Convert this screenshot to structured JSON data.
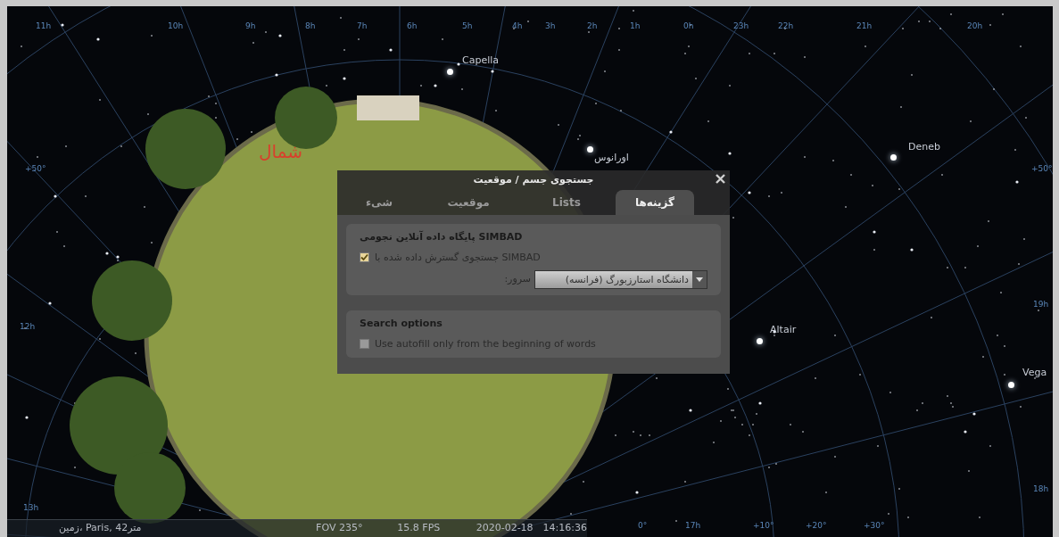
{
  "sky": {
    "hour_labels": [
      "11h",
      "10h",
      "9h",
      "8h",
      "7h",
      "6h",
      "5h",
      "4h",
      "3h",
      "2h",
      "1h",
      "0h",
      "23h",
      "22h",
      "21h",
      "20h"
    ],
    "side_labels": [
      "+50°",
      "12h",
      "13h"
    ],
    "right_labels": [
      "+50°",
      "19h",
      "18h"
    ],
    "bottom_labels": [
      "0°",
      "17h",
      "+10°",
      "+20°",
      "+30°"
    ],
    "star_labels": [
      {
        "name": "Capella"
      },
      {
        "name": "Deneb"
      },
      {
        "name": "Altair"
      },
      {
        "name": "Vega"
      },
      {
        "name": "اورانوس"
      }
    ],
    "cardinal": "شمال"
  },
  "dialog": {
    "title": "جستجوی جسم / موقعیت",
    "tabs": [
      {
        "label": "گزینه‌ها",
        "selected": true
      },
      {
        "label": "Lists",
        "selected": false
      },
      {
        "label": "موقعیت",
        "selected": false
      },
      {
        "label": "شیء",
        "selected": false
      }
    ],
    "groups": [
      {
        "kind": "simbad",
        "title": "SIMBAD پایگاه داده آنلاین نجومی",
        "checkbox": {
          "label": "SIMBAD جستجوی گسترش داده شده با",
          "checked": true
        },
        "server_label": "سرور:",
        "server_value": "دانشگاه استارزبورگ (فرانسه)"
      },
      {
        "kind": "options",
        "title": "Search options",
        "checkbox": {
          "label": "Use autofill only from the beginning of words",
          "checked": false
        }
      }
    ]
  },
  "status_bar": {
    "location": "زمین، Paris, 42متر",
    "fov": "FOV 235°",
    "fps": "15.8 FPS",
    "date": "2020-02-18",
    "time": "14:16:36"
  }
}
